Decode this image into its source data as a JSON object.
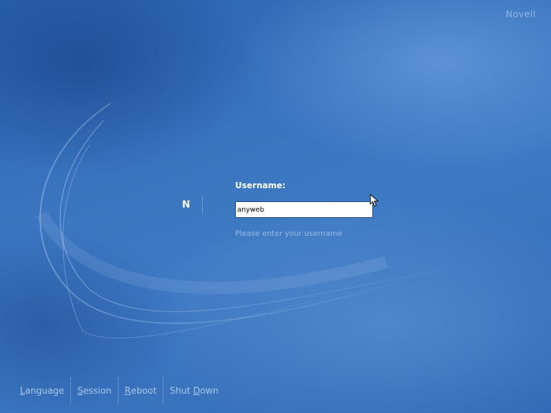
{
  "brand": {
    "label": "Novell"
  },
  "login": {
    "logo_letter": "N",
    "username_label": "Username:",
    "username_value": "anyweb",
    "hint": "Please enter your username"
  },
  "bottom_menu": {
    "items": [
      {
        "accel": "L",
        "rest": "anguage"
      },
      {
        "accel": "S",
        "rest": "ession"
      },
      {
        "accel": "R",
        "rest": "eboot"
      },
      {
        "prefix": "Shut ",
        "accel": "D",
        "rest": "own"
      }
    ]
  },
  "colors": {
    "background_blue": "#3a74bf",
    "label_white": "#ffffff",
    "hint_blue": "#9ab9e3",
    "menu_text": "#a9c6ea"
  },
  "icons": {
    "cursor": "arrow-pointer-icon"
  }
}
